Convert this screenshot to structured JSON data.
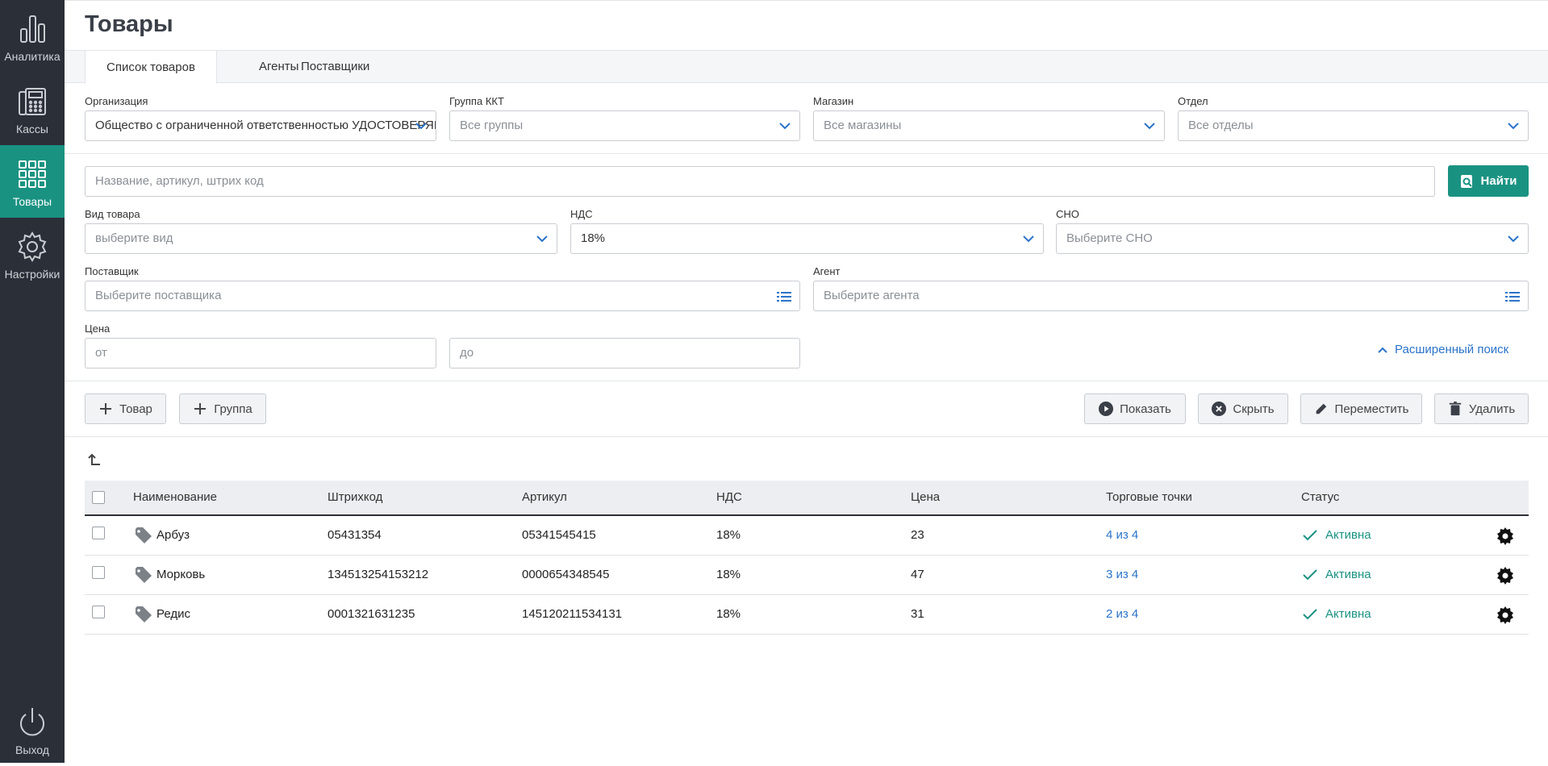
{
  "sidebar": {
    "items": [
      {
        "label": "Аналитика",
        "icon": "bar-chart-icon"
      },
      {
        "label": "Кассы",
        "icon": "cash-register-icon"
      },
      {
        "label": "Товары",
        "icon": "grid-icon"
      },
      {
        "label": "Настройки",
        "icon": "gear-icon"
      }
    ],
    "logout": {
      "label": "Выход",
      "icon": "power-icon"
    }
  },
  "page": {
    "title": "Товары"
  },
  "tabs": [
    {
      "label": "Список товаров",
      "active": true
    },
    {
      "label": "Агенты"
    },
    {
      "label": "Поставщики"
    }
  ],
  "filters": {
    "org": {
      "label": "Организация",
      "value": "Общество с ограниченной ответственностью УДОСТОВЕРЯЮЩИЙ ЦЕНТР"
    },
    "kkt_group": {
      "label": "Группа ККТ",
      "placeholder": "Все группы"
    },
    "shop": {
      "label": "Магазин",
      "placeholder": "Все магазины"
    },
    "dept": {
      "label": "Отдел",
      "placeholder": "Все отделы"
    },
    "search": {
      "placeholder": "Название, артикул, штрих код",
      "button": "Найти"
    },
    "kind": {
      "label": "Вид товара",
      "placeholder": "выберите вид"
    },
    "vat": {
      "label": "НДС",
      "value": "18%"
    },
    "sno": {
      "label": "СНО",
      "placeholder": "Выберите СНО"
    },
    "supplier": {
      "label": "Поставщик",
      "placeholder": "Выберите поставщика"
    },
    "agent": {
      "label": "Агент",
      "placeholder": "Выберите агента"
    },
    "price": {
      "label": "Цена",
      "from_placeholder": "от",
      "to_placeholder": "до"
    },
    "advanced": "Расширенный поиск"
  },
  "toolbar": {
    "add_item": "Товар",
    "add_group": "Группа",
    "show": "Показать",
    "hide": "Скрыть",
    "move": "Переместить",
    "delete": "Удалить"
  },
  "table": {
    "headers": [
      "Наименование",
      "Штрихкод",
      "Артикул",
      "НДС",
      "Цена",
      "Торговые точки",
      "Статус"
    ],
    "rows": [
      {
        "name": "Арбуз",
        "barcode": "05431354",
        "article": "05341545415",
        "vat": "18%",
        "price": "23",
        "points": "4 из 4",
        "status": "Активна"
      },
      {
        "name": "Морковь",
        "barcode": "134513254153212",
        "article": "0000654348545",
        "vat": "18%",
        "price": "47",
        "points": "3 из 4",
        "status": "Активна"
      },
      {
        "name": "Редис",
        "barcode": "0001321631235",
        "article": "145120211534131",
        "vat": "18%",
        "price": "31",
        "points": "2 из 4",
        "status": "Активна"
      }
    ]
  },
  "colors": {
    "accent": "#1a9282",
    "sidebar": "#2a2f38",
    "link": "#2a73c9"
  }
}
